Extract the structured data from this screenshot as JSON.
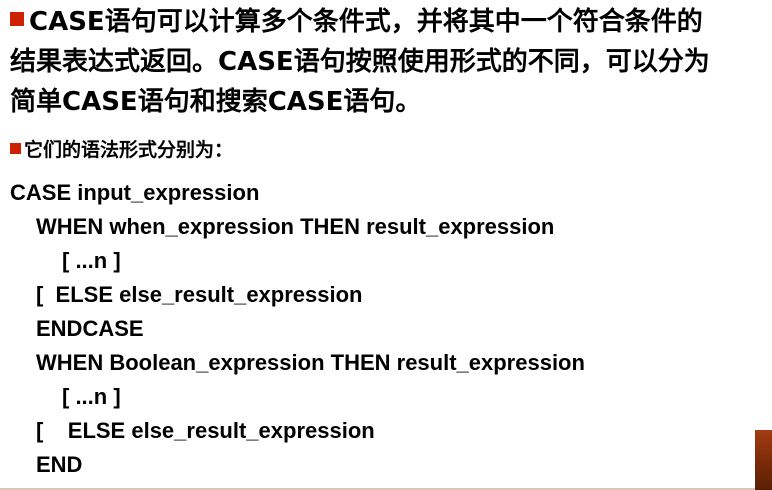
{
  "intro": {
    "line1": "CASE语句可以计算多个条件式，并将其中一个符合条件的",
    "line2": "结果表达式返回。CASE语句按照使用形式的不同，可以分为",
    "line3": "简单CASE语句和搜索CASE语句。"
  },
  "syntax_heading": "它们的语法形式分别为：",
  "code": [
    "CASE input_expression",
    "WHEN when_expression THEN result_expression",
    "[ ...n ]",
    "[  ELSE else_result_expression",
    "ENDCASE",
    "WHEN Boolean_expression THEN result_expression",
    "[ ...n ]",
    "[    ELSE else_result_expression",
    "END"
  ],
  "colors": {
    "bullet": "#cc2200",
    "accent": "#a33c12"
  }
}
